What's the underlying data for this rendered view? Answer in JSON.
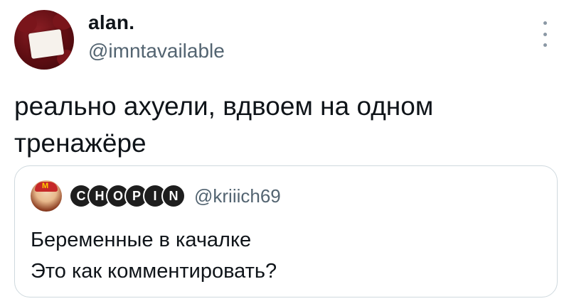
{
  "tweet": {
    "display_name": "alan.",
    "handle": "@imntavailable",
    "text": "реально ахуели, вдвоем на одном\nтренажёре",
    "more_icon": "more-vertical-icon"
  },
  "quote": {
    "name_letters": [
      "C",
      "H",
      "O",
      "P",
      "I",
      "N"
    ],
    "handle": "@kriiich69",
    "lines": [
      "Беременные в качалке",
      "Это как комментировать?"
    ]
  },
  "colors": {
    "text": "#0f1419",
    "secondary": "#536471",
    "border": "#cfd9de",
    "bubble": "#1e1e1e"
  }
}
